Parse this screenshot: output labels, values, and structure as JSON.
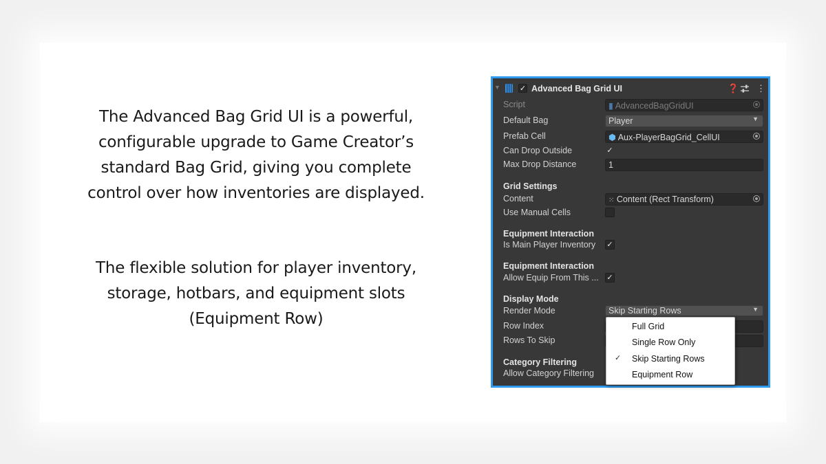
{
  "slide": {
    "paragraph1": [
      "The Advanced Bag Grid UI is a powerful,",
      "configurable upgrade to Game Creator’s",
      "standard Bag Grid, giving you complete",
      "control over how inventories are displayed."
    ],
    "paragraph2": [
      "The flexible solution for player inventory,",
      "storage, hotbars, and equipment slots",
      "(Equipment Row)"
    ]
  },
  "inspector": {
    "accent_color": "#2f9bf0",
    "title": "Advanced Bag Grid UI",
    "icons": [
      "foldout-arrow-icon",
      "script-icon",
      "help-icon",
      "preset-icon",
      "kebab-menu-icon"
    ],
    "script_label": "Script",
    "script_value": "AdvancedBagGridUI",
    "default_bag_label": "Default Bag",
    "default_bag_value": "Player",
    "prefab_cell_label": "Prefab Cell",
    "prefab_cell_value": "Aux-PlayerBagGrid_CellUI",
    "can_drop_outside_label": "Can Drop Outside",
    "can_drop_outside_checked": true,
    "max_drop_distance_label": "Max Drop Distance",
    "max_drop_distance_value": "1",
    "grid_settings_header": "Grid Settings",
    "content_label": "Content",
    "content_value": "Content (Rect Transform)",
    "use_manual_cells_label": "Use Manual Cells",
    "use_manual_cells_checked": false,
    "equip_header_1": "Equipment Interaction",
    "is_main_player_inventory_label": "Is Main Player Inventory",
    "is_main_player_inventory_checked": true,
    "equip_header_2": "Equipment Interaction",
    "allow_equip_label": "Allow Equip From This ...",
    "allow_equip_checked": true,
    "display_mode_header": "Display Mode",
    "render_mode_label": "Render Mode",
    "render_mode_value": "Skip Starting Rows",
    "row_index_label": "Row Index",
    "rows_to_skip_label": "Rows To Skip",
    "category_filtering_header": "Category Filtering",
    "allow_category_filtering_label": "Allow Category Filtering"
  },
  "render_mode_popup": {
    "selected": "Skip Starting Rows",
    "options": [
      "Full Grid",
      "Single Row Only",
      "Skip Starting Rows",
      "Equipment Row"
    ],
    "tick_glyph": "✓"
  }
}
